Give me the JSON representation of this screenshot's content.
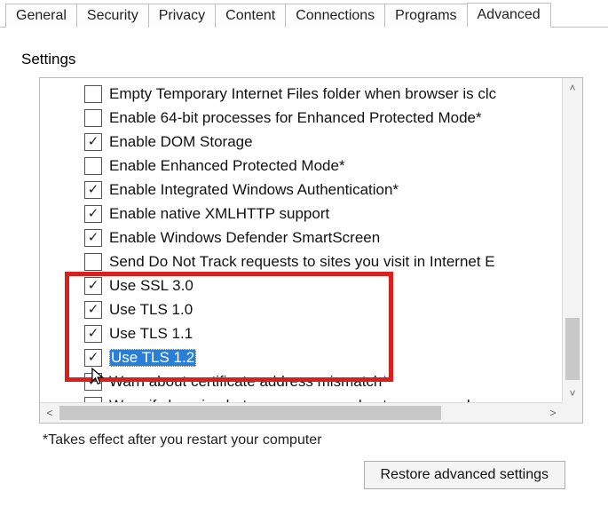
{
  "tabs": [
    {
      "label": "General",
      "active": false
    },
    {
      "label": "Security",
      "active": false
    },
    {
      "label": "Privacy",
      "active": false
    },
    {
      "label": "Content",
      "active": false
    },
    {
      "label": "Connections",
      "active": false
    },
    {
      "label": "Programs",
      "active": false
    },
    {
      "label": "Advanced",
      "active": true
    }
  ],
  "group_label": "Settings",
  "items": [
    {
      "checked": false,
      "label": "Empty Temporary Internet Files folder when browser is clc",
      "selected": false
    },
    {
      "checked": false,
      "label": "Enable 64-bit processes for Enhanced Protected Mode*",
      "selected": false
    },
    {
      "checked": true,
      "label": "Enable DOM Storage",
      "selected": false
    },
    {
      "checked": false,
      "label": "Enable Enhanced Protected Mode*",
      "selected": false
    },
    {
      "checked": true,
      "label": "Enable Integrated Windows Authentication*",
      "selected": false
    },
    {
      "checked": true,
      "label": "Enable native XMLHTTP support",
      "selected": false
    },
    {
      "checked": true,
      "label": "Enable Windows Defender SmartScreen",
      "selected": false
    },
    {
      "checked": false,
      "label": "Send Do Not Track requests to sites you visit in Internet E",
      "selected": false
    },
    {
      "checked": true,
      "label": "Use SSL 3.0",
      "selected": false
    },
    {
      "checked": true,
      "label": "Use TLS 1.0",
      "selected": false
    },
    {
      "checked": true,
      "label": "Use TLS 1.1",
      "selected": false
    },
    {
      "checked": true,
      "label": "Use TLS 1.2",
      "selected": true
    },
    {
      "checked": true,
      "label": "Warn about certificate address mismatch*",
      "selected": false
    },
    {
      "checked": false,
      "label": "Warn if changing between secure and not secure mode",
      "selected": false
    }
  ],
  "note": "*Takes effect after you restart your computer",
  "restore_button": "Restore advanced settings",
  "highlight_row_start": 8,
  "highlight_row_end": 11
}
